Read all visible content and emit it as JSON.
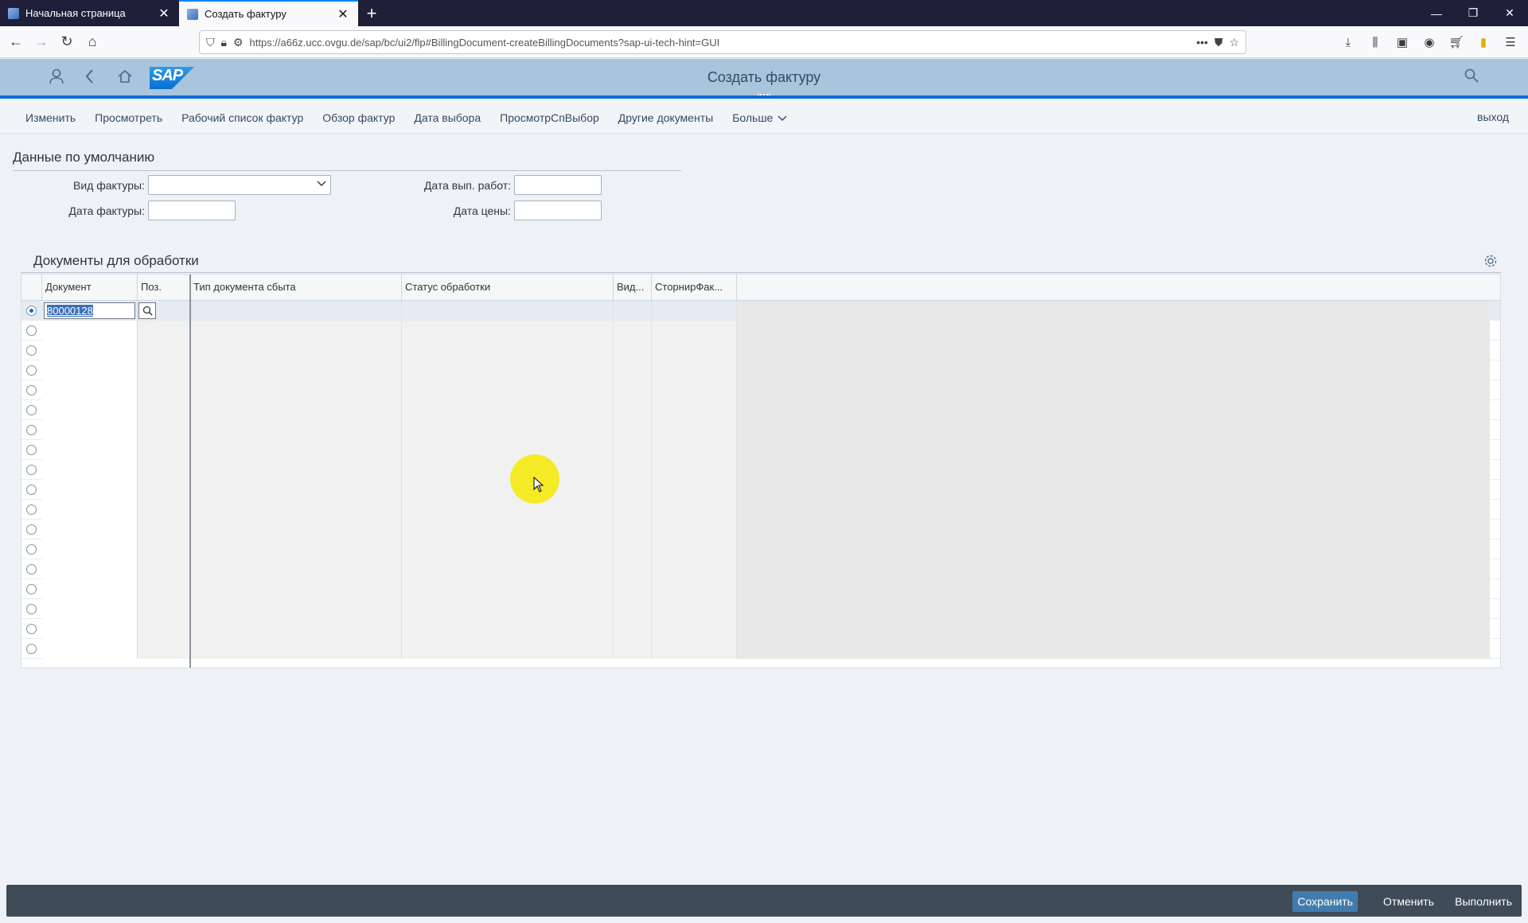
{
  "browser": {
    "tabs": [
      {
        "label": "Начальная страница",
        "active": false
      },
      {
        "label": "Создать фактуру",
        "active": true
      }
    ],
    "url": "https://a66z.ucc.ovgu.de/sap/bc/ui2/flp#BillingDocument-createBillingDocuments?sap-ui-tech-hint=GUI"
  },
  "shell": {
    "title": "Создать фактуру",
    "logo": "SAP"
  },
  "toolbar": {
    "items": [
      "Изменить",
      "Просмотреть",
      "Рабочий список фактур",
      "Обзор фактур",
      "Дата выбора",
      "ПросмотрСпВыбор",
      "Другие документы",
      "Больше"
    ],
    "exit": "выход"
  },
  "defaults": {
    "title": "Данные по умолчанию",
    "billing_type_label": "Вид фактуры:",
    "billing_type_value": "",
    "billing_date_label": "Дата фактуры:",
    "billing_date_value": "",
    "service_date_label": "Дата вып. работ:",
    "service_date_value": "",
    "pricing_date_label": "Дата цены:",
    "pricing_date_value": ""
  },
  "documents": {
    "title": "Документы для обработки",
    "columns": [
      "Документ",
      "Поз.",
      "Тип документа сбыта",
      "Статус обработки",
      "Вид...",
      "СторнирФак..."
    ],
    "first_document": "80000128",
    "row_count": 18
  },
  "footer": {
    "save": "Сохранить",
    "cancel": "Отменить",
    "execute": "Выполнить"
  },
  "colors": {
    "shell_bg": "#a9c4dd",
    "accent": "#0a6ed1",
    "footer_bg": "#3f4b57",
    "primary_button": "#427cac",
    "cursor_highlight": "#f3ea1a"
  }
}
